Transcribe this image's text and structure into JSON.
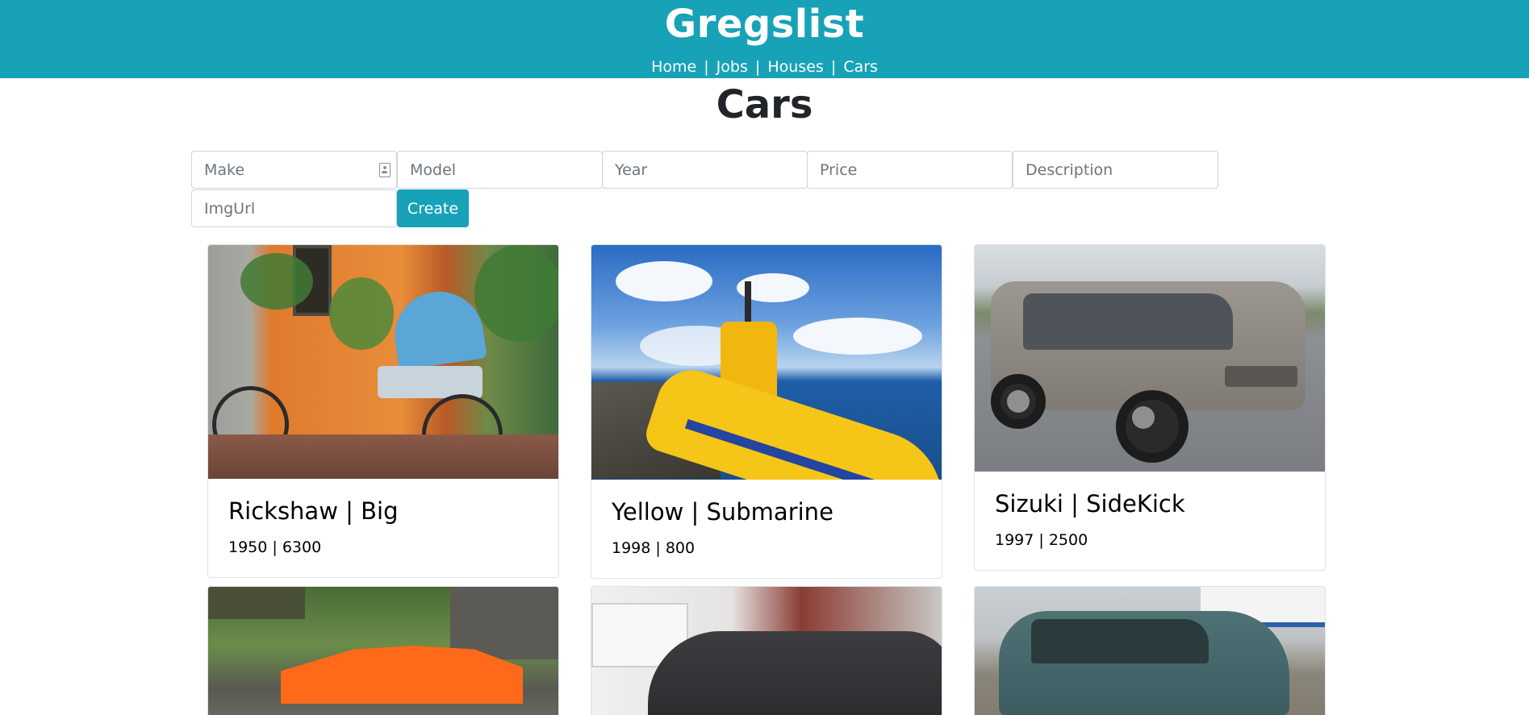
{
  "header": {
    "title": "Gregslist",
    "nav": [
      {
        "label": "Home"
      },
      {
        "label": "Jobs"
      },
      {
        "label": "Houses"
      },
      {
        "label": "Cars"
      }
    ],
    "nav_separator": "|",
    "background": "#17a2b8"
  },
  "page": {
    "title": "Cars"
  },
  "form": {
    "make_placeholder": "Make",
    "model_placeholder": "Model",
    "year_placeholder": "Year",
    "price_placeholder": "Price",
    "description_placeholder": "Description",
    "imgurl_placeholder": "ImgUrl",
    "create_label": "Create",
    "make_icon": "contact-card-icon"
  },
  "cars": [
    {
      "title": "Rickshaw | Big",
      "details": "1950 | 6300",
      "image": "rickshaw-photo"
    },
    {
      "title": "Yellow | Submarine",
      "details": "1998 | 800",
      "image": "yellow-submarine-photo"
    },
    {
      "title": "Sizuki | SideKick",
      "details": "1997 | 2500",
      "image": "suzuki-sidekick-photo"
    },
    {
      "title": "",
      "details": "",
      "image": "minecraft-lamborghini-photo"
    },
    {
      "title": "",
      "details": "",
      "image": "dark-sedan-photo"
    },
    {
      "title": "",
      "details": "",
      "image": "teal-sedan-photo"
    }
  ]
}
